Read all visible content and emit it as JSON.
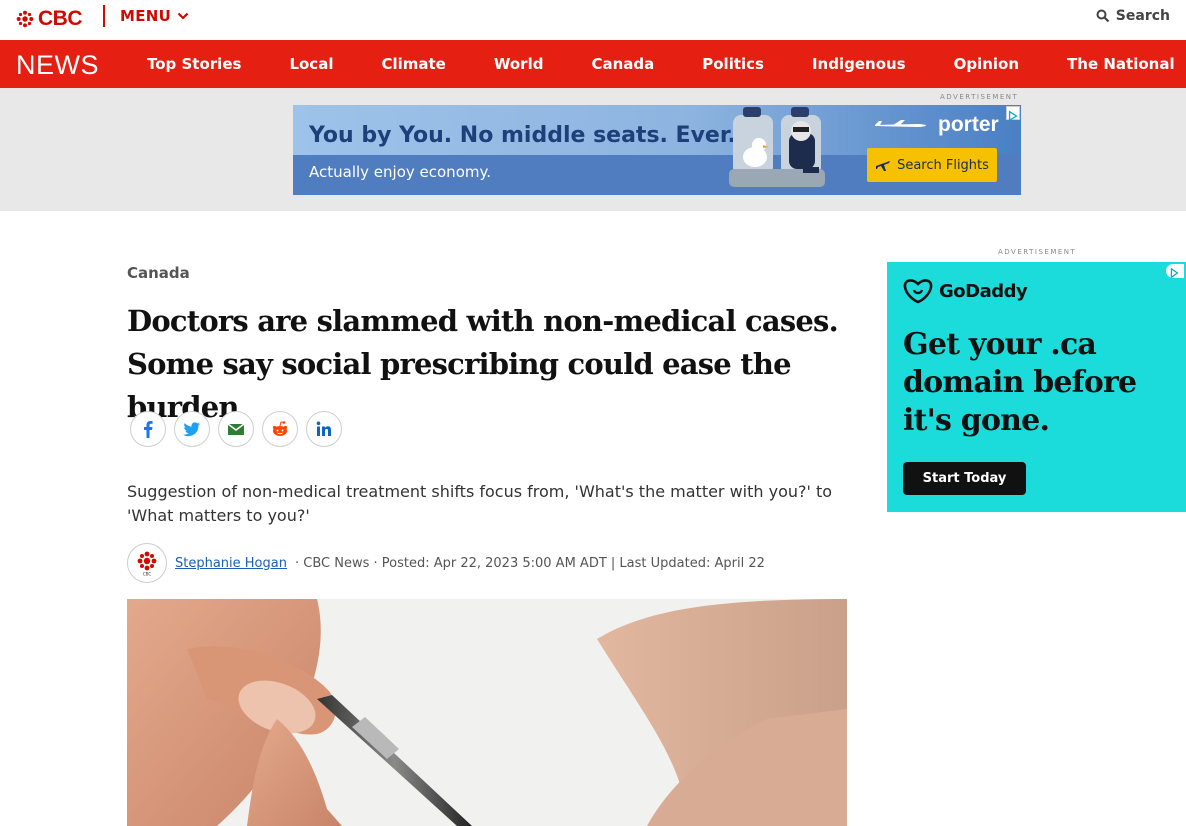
{
  "header": {
    "logo_text": "CBC",
    "menu_label": "MENU",
    "search_label": "Search"
  },
  "nav": {
    "brand": "NEWS",
    "items": [
      "Top Stories",
      "Local",
      "Climate",
      "World",
      "Canada",
      "Politics",
      "Indigenous",
      "Opinion",
      "The National"
    ]
  },
  "top_ad": {
    "tag": "ADVERTISEMENT",
    "headline": "You by You. No middle seats. Ever.",
    "subline": "Actually enjoy economy.",
    "brand": "porter",
    "cta": "Search Flights"
  },
  "article": {
    "section": "Canada",
    "headline": "Doctors are slammed with non-medical cases. Some say social prescribing could ease the burden",
    "dek": "Suggestion of non-medical treatment shifts focus from, 'What's the matter with you?' to 'What matters to you?'",
    "author": "Stephanie Hogan",
    "byline_meta": "· CBC News · Posted: Apr 22, 2023 5:00 AM ADT | Last Updated: April 22",
    "share_icons": [
      "facebook-icon",
      "twitter-icon",
      "email-icon",
      "reddit-icon",
      "linkedin-icon"
    ]
  },
  "side_ad": {
    "tag": "ADVERTISEMENT",
    "brand": "GoDaddy",
    "copy": "Get your .ca domain before it's gone.",
    "cta": "Start Today"
  },
  "colors": {
    "cbc_red": "#e51f12",
    "godaddy_teal": "#1bdbdb",
    "porter_yellow": "#f5c100"
  }
}
